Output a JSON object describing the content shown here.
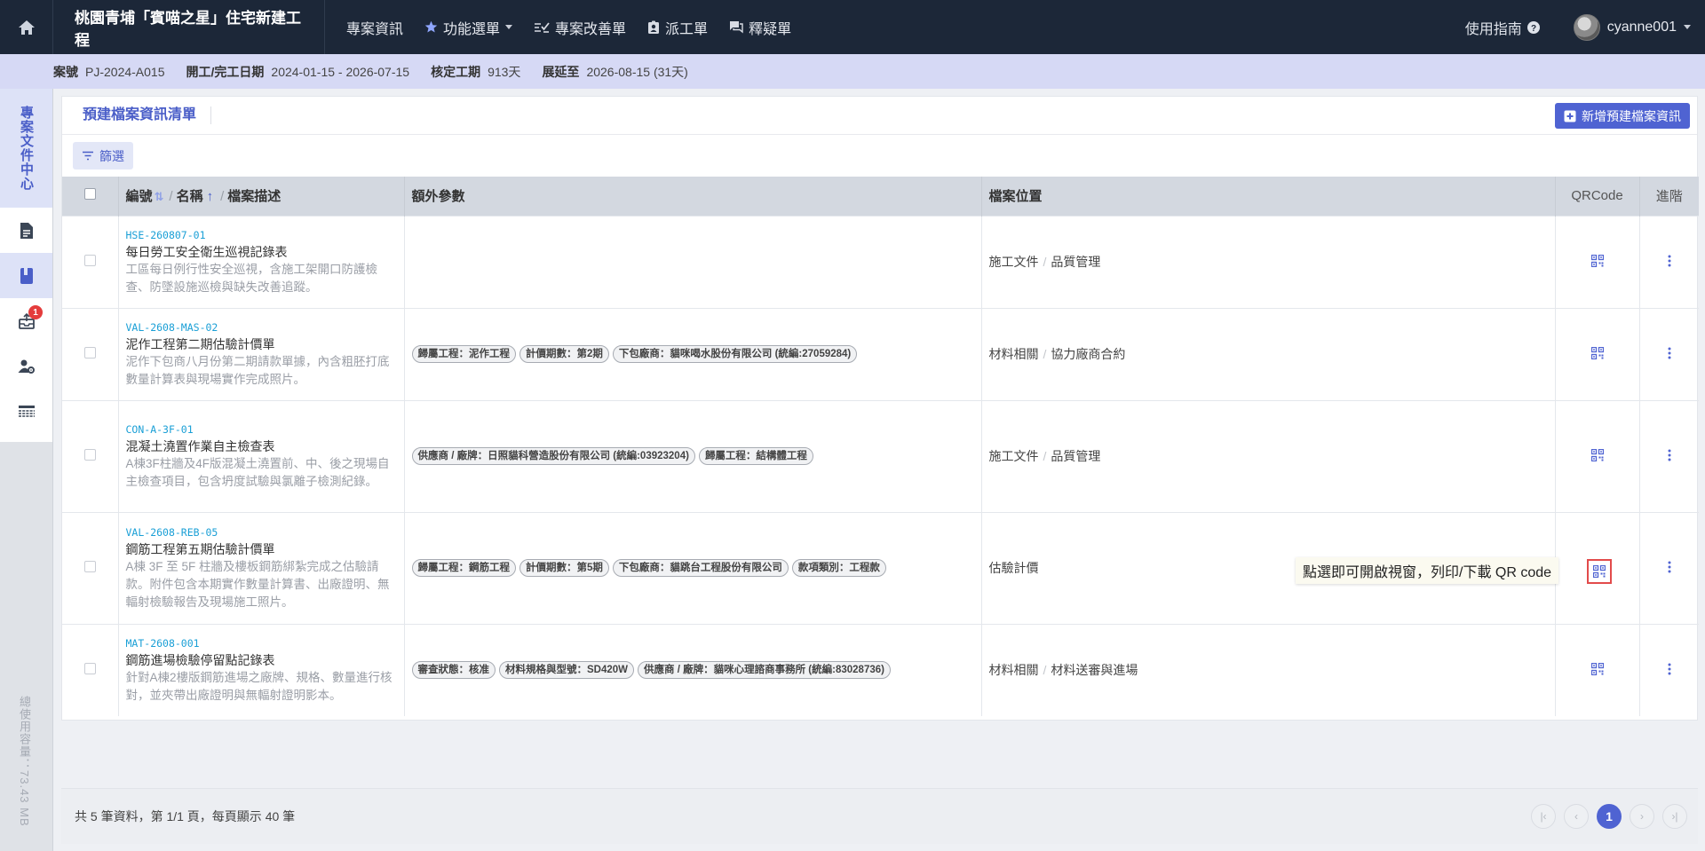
{
  "topnav": {
    "project_title": "桃園青埔「賓喵之星」住宅新建工程",
    "items": [
      {
        "label": "專案資訊",
        "icon": ""
      },
      {
        "label": "功能選單",
        "icon": "star-icon"
      },
      {
        "label": "專案改善單",
        "icon": "checklist-icon"
      },
      {
        "label": "派工單",
        "icon": "badge-icon"
      },
      {
        "label": "釋疑單",
        "icon": "chat-icon"
      }
    ],
    "guide_label": "使用指南",
    "username": "cyanne001"
  },
  "infostrip": {
    "case_label": "案號",
    "case_value": "PJ-2024-A015",
    "dates_label": "開工/完工日期",
    "dates_value": "2024-01-15 - 2026-07-15",
    "period_label": "核定工期",
    "period_value": "913天",
    "extend_label": "展延至",
    "extend_value": "2026-08-15 (31天)"
  },
  "sidebar": {
    "header": "專案文件中心",
    "notification_badge": "1",
    "usage_text": "總使用容量：73.43 MB"
  },
  "panel": {
    "title": "預建檔案資訊清單",
    "add_button": "新增預建檔案資訊",
    "filter_button": "篩選"
  },
  "table": {
    "headers": {
      "code": "編號",
      "name": "名稱",
      "desc": "檔案描述",
      "params": "額外參數",
      "location": "檔案位置",
      "qr": "QRCode",
      "advanced": "進階"
    },
    "rows": [
      {
        "code": "HSE-260807-01",
        "name": "每日勞工安全衛生巡視記錄表",
        "desc": "工區每日例行性安全巡視，含施工架開口防護檢查、防墜設施巡檢與缺失改善追蹤。",
        "tags": [],
        "loc_main": "施工文件",
        "loc_sub": "品質管理"
      },
      {
        "code": "VAL-2608-MAS-02",
        "name": "泥作工程第二期估驗計價單",
        "desc": "泥作下包商八月份第二期請款單據，內含粗胚打底數量計算表與現場實作完成照片。",
        "tags": [
          "歸屬工程：泥作工程",
          "計價期數：第2期",
          "下包廠商：貓咪喝水股份有限公司 (統編:27059284)"
        ],
        "loc_main": "材料相關",
        "loc_sub": "協力廠商合約"
      },
      {
        "code": "CON-A-3F-01",
        "name": "混凝土澆置作業自主檢查表",
        "desc": "A棟3F柱牆及4F版混凝土澆置前、中、後之現場自主檢查項目，包含坍度試驗與氯離子檢測紀錄。",
        "tags": [
          "供應商 / 廠牌：日照貓科營造股份有限公司 (統編:03923204)",
          "歸屬工程：結構體工程"
        ],
        "loc_main": "施工文件",
        "loc_sub": "品質管理"
      },
      {
        "code": "VAL-2608-REB-05",
        "name": "鋼筋工程第五期估驗計價單",
        "desc": "A棟 3F 至 5F 柱牆及樓板鋼筋綁紮完成之估驗請款。附件包含本期實作數量計算書、出廠證明、無輻射檢驗報告及現場施工照片。",
        "tags": [
          "歸屬工程：鋼筋工程",
          "計價期數：第5期",
          "下包廠商：貓跳台工程股份有限公司",
          "款項類別：工程款"
        ],
        "loc_main": "估驗計價",
        "loc_sub": ""
      },
      {
        "code": "MAT-2608-001",
        "name": "鋼筋進場檢驗停留點記錄表",
        "desc": "針對A棟2樓版鋼筋進場之廠牌、規格、數量進行核對，並夾帶出廠證明與無輻射證明影本。",
        "tags": [
          "審查狀態：核准",
          "材料規格與型號：SD420W",
          "供應商 / 廠牌：貓咪心理諮商事務所 (統編:83028736)"
        ],
        "loc_main": "材料相關",
        "loc_sub": "材料送審與進場"
      }
    ]
  },
  "tooltip": "點選即可開啟視窗，列印/下載 QR code",
  "footer": {
    "summary": "共 5 筆資料，第 1/1 頁，每頁顯示 40 筆",
    "current_page": "1"
  },
  "colors": {
    "topnav_bg": "#1c2738",
    "accent": "#4f63d2",
    "code_blue": "#1a9fd6",
    "info_strip": "#d6d9f5",
    "badge_red": "#e43c3c"
  }
}
